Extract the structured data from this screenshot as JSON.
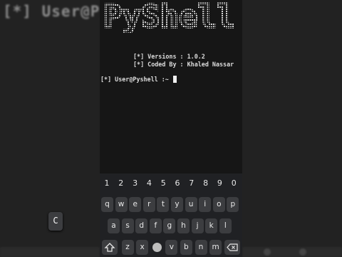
{
  "backdrop": {
    "left_text": "[*] User@Py"
  },
  "terminal": {
    "logo_text": "PyShell",
    "versions_line": "[*] Versions : 1.0.2",
    "coded_line": "[*] Coded By : Khaled Nassar",
    "prompt": "[*] User@Pyshell :~"
  },
  "keyboard": {
    "numbers": [
      "1",
      "2",
      "3",
      "4",
      "5",
      "6",
      "7",
      "8",
      "9",
      "0"
    ],
    "row1": [
      "q",
      "w",
      "e",
      "r",
      "t",
      "y",
      "u",
      "i",
      "o",
      "p"
    ],
    "row2": [
      "a",
      "s",
      "d",
      "f",
      "g",
      "h",
      "j",
      "k",
      "l"
    ],
    "row3": [
      "z",
      "x",
      "c",
      "v",
      "b",
      "n",
      "m"
    ],
    "popup_key": "C",
    "shift_icon": "shift-icon",
    "backspace_icon": "backspace-icon"
  },
  "colors": {
    "terminal_bg": "#161616",
    "keyboard_bg": "#202124",
    "key_bg": "#3c3d40",
    "text": "#dcdcdc"
  }
}
